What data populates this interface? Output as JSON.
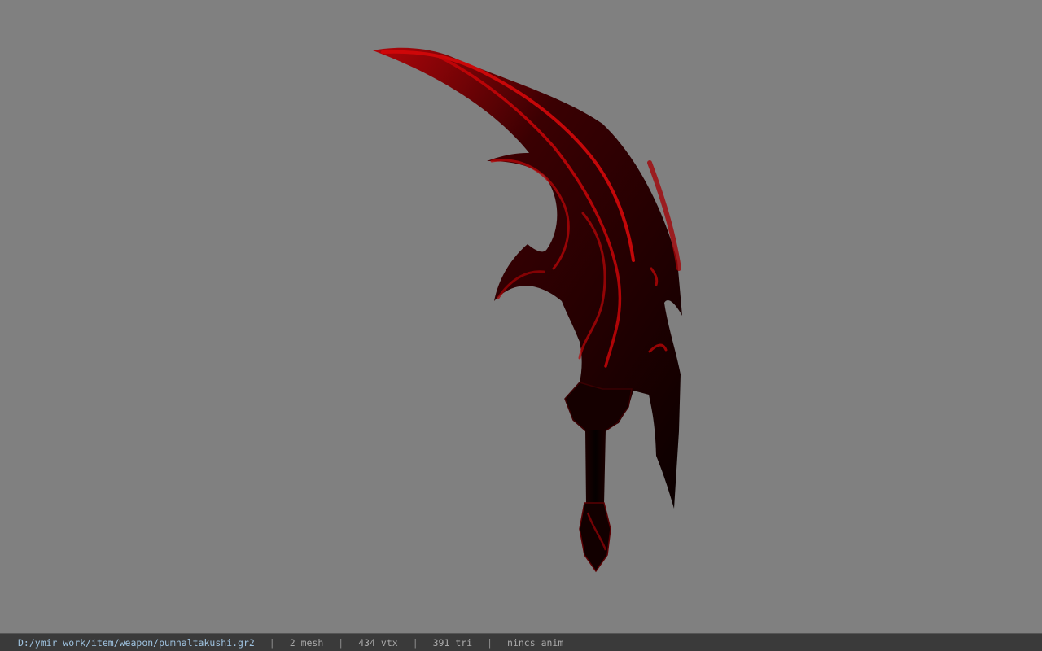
{
  "viewer": {
    "background_color": "#808080"
  },
  "model": {
    "icon": "curved-blade-weapon",
    "base_color": "#0a0000",
    "glow_color": "#d4080a"
  },
  "status_bar": {
    "file_path": "D:/ymir work/item/weapon/pumnaltakushi.gr2",
    "separator": "|",
    "mesh_count": "2 mesh",
    "vertex_count": "434 vtx",
    "triangle_count": "391 tri",
    "animation_status": "nincs anim"
  }
}
